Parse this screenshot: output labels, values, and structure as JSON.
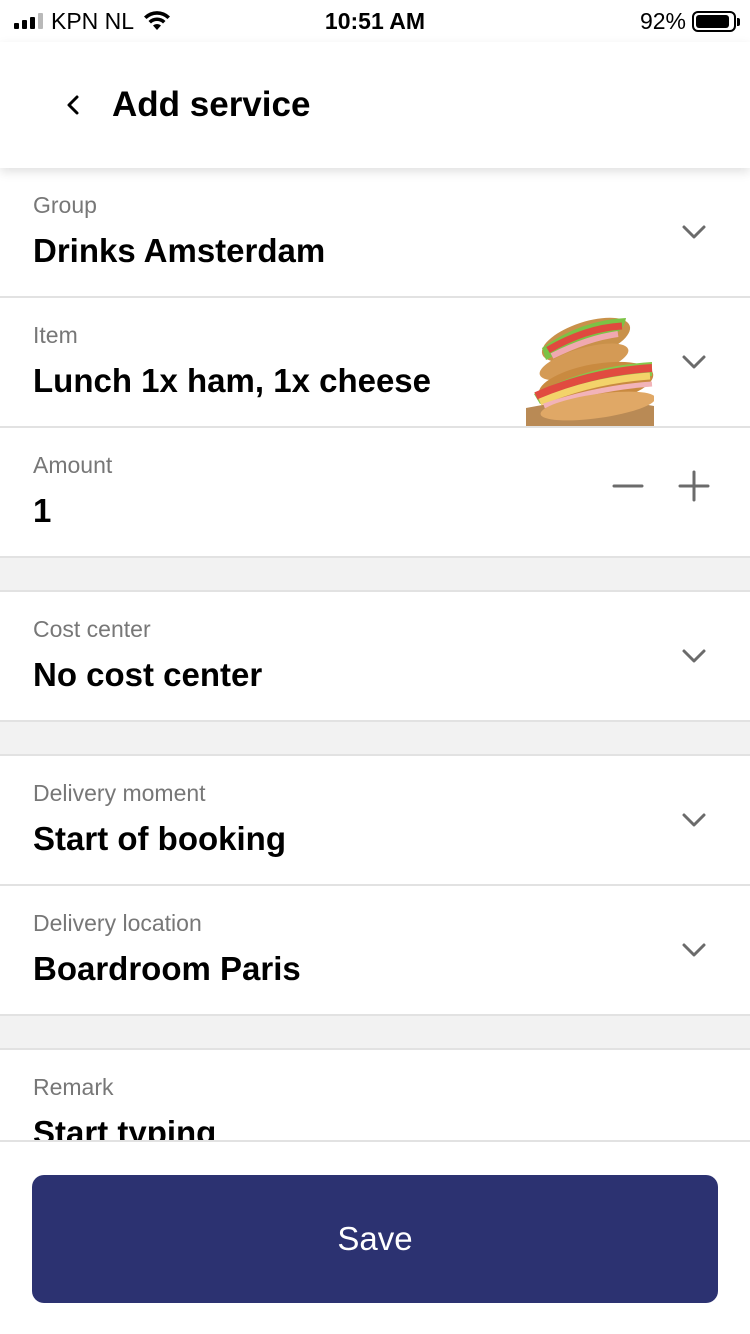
{
  "status_bar": {
    "carrier": "KPN NL",
    "time": "10:51 AM",
    "battery_percent": "92%",
    "battery_level": 0.92
  },
  "header": {
    "title": "Add service",
    "back_icon": "chevron-left-icon"
  },
  "fields": {
    "group": {
      "label": "Group",
      "value": "Drinks Amsterdam"
    },
    "item": {
      "label": "Item",
      "value": "Lunch 1x ham, 1x cheese"
    },
    "amount": {
      "label": "Amount",
      "value": "1"
    },
    "cost_center": {
      "label": "Cost center",
      "value": "No cost center"
    },
    "delivery_moment": {
      "label": "Delivery moment",
      "value": "Start of booking"
    },
    "delivery_location": {
      "label": "Delivery location",
      "value": "Boardroom Paris"
    },
    "remark": {
      "label": "Remark",
      "placeholder": "Start typing"
    }
  },
  "footer": {
    "save_label": "Save"
  },
  "colors": {
    "accent": "#2c3271",
    "label_gray": "#777777",
    "divider": "#e2e2e2",
    "section_gap": "#f2f2f2"
  }
}
